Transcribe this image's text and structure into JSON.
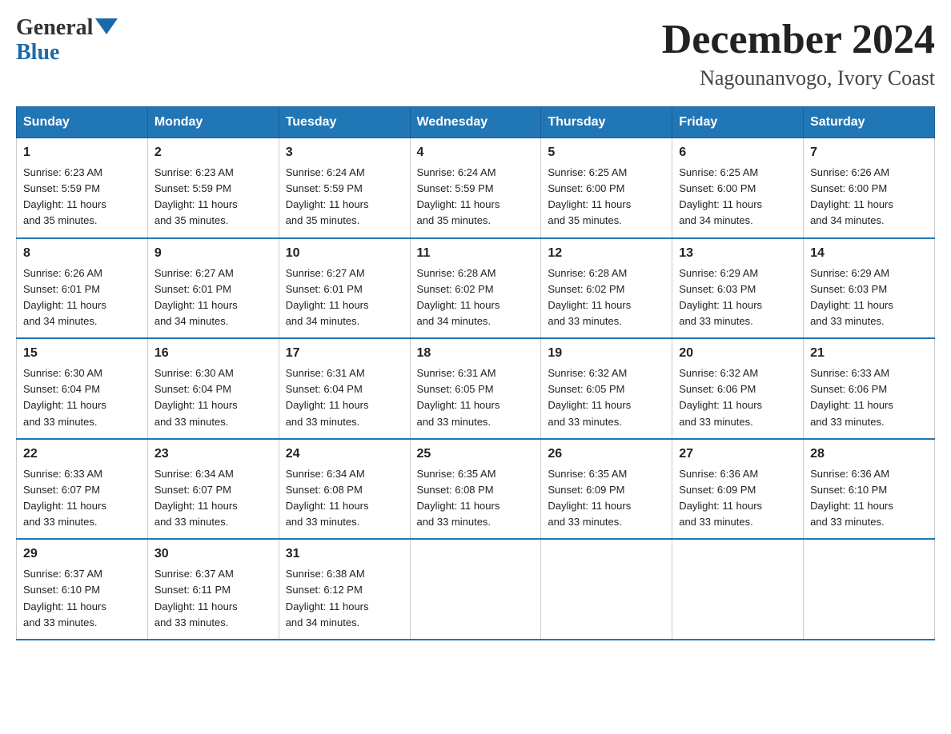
{
  "logo": {
    "general": "General",
    "blue": "Blue",
    "triangle": "▲"
  },
  "title": "December 2024",
  "location": "Nagounanvogo, Ivory Coast",
  "headers": [
    "Sunday",
    "Monday",
    "Tuesday",
    "Wednesday",
    "Thursday",
    "Friday",
    "Saturday"
  ],
  "weeks": [
    [
      {
        "day": "1",
        "info": "Sunrise: 6:23 AM\nSunset: 5:59 PM\nDaylight: 11 hours\nand 35 minutes."
      },
      {
        "day": "2",
        "info": "Sunrise: 6:23 AM\nSunset: 5:59 PM\nDaylight: 11 hours\nand 35 minutes."
      },
      {
        "day": "3",
        "info": "Sunrise: 6:24 AM\nSunset: 5:59 PM\nDaylight: 11 hours\nand 35 minutes."
      },
      {
        "day": "4",
        "info": "Sunrise: 6:24 AM\nSunset: 5:59 PM\nDaylight: 11 hours\nand 35 minutes."
      },
      {
        "day": "5",
        "info": "Sunrise: 6:25 AM\nSunset: 6:00 PM\nDaylight: 11 hours\nand 35 minutes."
      },
      {
        "day": "6",
        "info": "Sunrise: 6:25 AM\nSunset: 6:00 PM\nDaylight: 11 hours\nand 34 minutes."
      },
      {
        "day": "7",
        "info": "Sunrise: 6:26 AM\nSunset: 6:00 PM\nDaylight: 11 hours\nand 34 minutes."
      }
    ],
    [
      {
        "day": "8",
        "info": "Sunrise: 6:26 AM\nSunset: 6:01 PM\nDaylight: 11 hours\nand 34 minutes."
      },
      {
        "day": "9",
        "info": "Sunrise: 6:27 AM\nSunset: 6:01 PM\nDaylight: 11 hours\nand 34 minutes."
      },
      {
        "day": "10",
        "info": "Sunrise: 6:27 AM\nSunset: 6:01 PM\nDaylight: 11 hours\nand 34 minutes."
      },
      {
        "day": "11",
        "info": "Sunrise: 6:28 AM\nSunset: 6:02 PM\nDaylight: 11 hours\nand 34 minutes."
      },
      {
        "day": "12",
        "info": "Sunrise: 6:28 AM\nSunset: 6:02 PM\nDaylight: 11 hours\nand 33 minutes."
      },
      {
        "day": "13",
        "info": "Sunrise: 6:29 AM\nSunset: 6:03 PM\nDaylight: 11 hours\nand 33 minutes."
      },
      {
        "day": "14",
        "info": "Sunrise: 6:29 AM\nSunset: 6:03 PM\nDaylight: 11 hours\nand 33 minutes."
      }
    ],
    [
      {
        "day": "15",
        "info": "Sunrise: 6:30 AM\nSunset: 6:04 PM\nDaylight: 11 hours\nand 33 minutes."
      },
      {
        "day": "16",
        "info": "Sunrise: 6:30 AM\nSunset: 6:04 PM\nDaylight: 11 hours\nand 33 minutes."
      },
      {
        "day": "17",
        "info": "Sunrise: 6:31 AM\nSunset: 6:04 PM\nDaylight: 11 hours\nand 33 minutes."
      },
      {
        "day": "18",
        "info": "Sunrise: 6:31 AM\nSunset: 6:05 PM\nDaylight: 11 hours\nand 33 minutes."
      },
      {
        "day": "19",
        "info": "Sunrise: 6:32 AM\nSunset: 6:05 PM\nDaylight: 11 hours\nand 33 minutes."
      },
      {
        "day": "20",
        "info": "Sunrise: 6:32 AM\nSunset: 6:06 PM\nDaylight: 11 hours\nand 33 minutes."
      },
      {
        "day": "21",
        "info": "Sunrise: 6:33 AM\nSunset: 6:06 PM\nDaylight: 11 hours\nand 33 minutes."
      }
    ],
    [
      {
        "day": "22",
        "info": "Sunrise: 6:33 AM\nSunset: 6:07 PM\nDaylight: 11 hours\nand 33 minutes."
      },
      {
        "day": "23",
        "info": "Sunrise: 6:34 AM\nSunset: 6:07 PM\nDaylight: 11 hours\nand 33 minutes."
      },
      {
        "day": "24",
        "info": "Sunrise: 6:34 AM\nSunset: 6:08 PM\nDaylight: 11 hours\nand 33 minutes."
      },
      {
        "day": "25",
        "info": "Sunrise: 6:35 AM\nSunset: 6:08 PM\nDaylight: 11 hours\nand 33 minutes."
      },
      {
        "day": "26",
        "info": "Sunrise: 6:35 AM\nSunset: 6:09 PM\nDaylight: 11 hours\nand 33 minutes."
      },
      {
        "day": "27",
        "info": "Sunrise: 6:36 AM\nSunset: 6:09 PM\nDaylight: 11 hours\nand 33 minutes."
      },
      {
        "day": "28",
        "info": "Sunrise: 6:36 AM\nSunset: 6:10 PM\nDaylight: 11 hours\nand 33 minutes."
      }
    ],
    [
      {
        "day": "29",
        "info": "Sunrise: 6:37 AM\nSunset: 6:10 PM\nDaylight: 11 hours\nand 33 minutes."
      },
      {
        "day": "30",
        "info": "Sunrise: 6:37 AM\nSunset: 6:11 PM\nDaylight: 11 hours\nand 33 minutes."
      },
      {
        "day": "31",
        "info": "Sunrise: 6:38 AM\nSunset: 6:12 PM\nDaylight: 11 hours\nand 34 minutes."
      },
      {
        "day": "",
        "info": ""
      },
      {
        "day": "",
        "info": ""
      },
      {
        "day": "",
        "info": ""
      },
      {
        "day": "",
        "info": ""
      }
    ]
  ],
  "colors": {
    "header_bg": "#2176b5",
    "header_text": "#ffffff",
    "border_bottom": "#2176b5",
    "cell_border": "#cccccc"
  }
}
